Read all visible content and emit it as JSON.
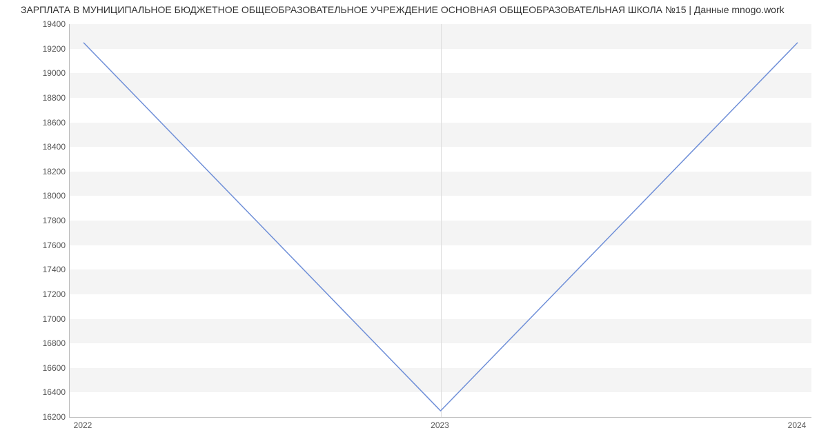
{
  "chart_data": {
    "type": "line",
    "title": "ЗАРПЛАТА В МУНИЦИПАЛЬНОЕ БЮДЖЕТНОЕ ОБЩЕОБРАЗОВАТЕЛЬНОЕ УЧРЕЖДЕНИЕ ОСНОВНАЯ ОБЩЕОБРАЗОВАТЕЛЬНАЯ ШКОЛА №15 | Данные mnogo.work",
    "categories": [
      "2022",
      "2023",
      "2024"
    ],
    "values": [
      19250,
      16250,
      19250
    ],
    "xlabel": "",
    "ylabel": "",
    "ylim": [
      16200,
      19400
    ],
    "y_ticks": [
      16200,
      16400,
      16600,
      16800,
      17000,
      17200,
      17400,
      17600,
      17800,
      18000,
      18200,
      18400,
      18600,
      18800,
      19000,
      19200,
      19400
    ],
    "x_ticks": [
      "2022",
      "2023",
      "2024"
    ],
    "line_color": "#6f8fd8"
  }
}
